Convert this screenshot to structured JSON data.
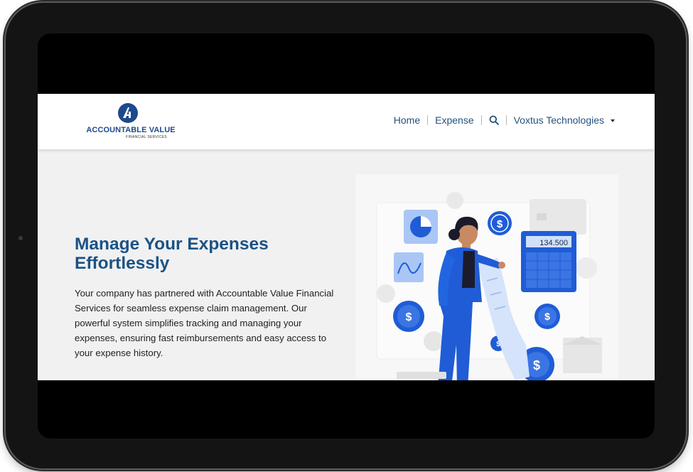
{
  "brand": {
    "name": "ACCOUNTABLE VALUE",
    "tagline": "FINANCIAL SERVICES",
    "accent": "#1b5286"
  },
  "nav": {
    "home_label": "Home",
    "expense_label": "Expense",
    "search_icon": "search-icon",
    "company_label": "Voxtus Technologies",
    "company_icon": "caret-down-icon"
  },
  "hero": {
    "title": "Manage Your Expenses Effortlessly",
    "body": "Your company has partnered with Accountable Value Financial Services for seamless expense claim management. Our powerful system simplifies tracking and managing your expenses, ensuring fast reimbursements and easy access to your expense history."
  },
  "illustration": {
    "calculator_display": "134.500",
    "dollar_symbol": "$",
    "colors": {
      "primary_blue": "#1f5cd6",
      "light_blue": "#a9c6f5",
      "grey": "#d8d8d8"
    }
  }
}
